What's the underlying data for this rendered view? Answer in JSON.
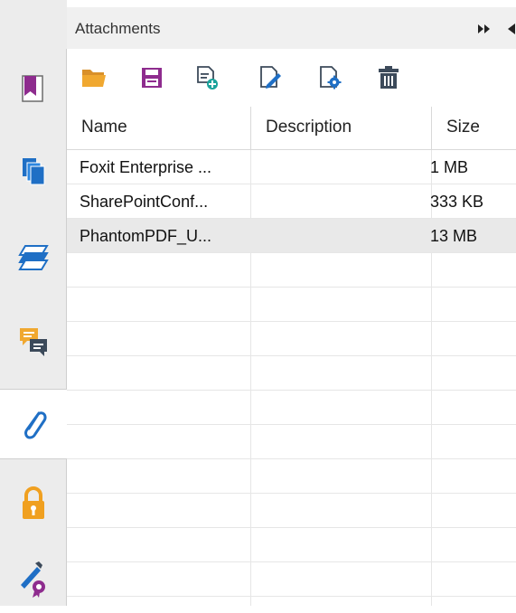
{
  "panel": {
    "title": "Attachments"
  },
  "toolbar": {
    "buttons": [
      "open-icon",
      "save-icon",
      "add-file-icon",
      "edit-description-icon",
      "properties-icon",
      "delete-icon"
    ]
  },
  "table": {
    "columns": [
      "Name",
      "Description",
      "Size"
    ],
    "rows": [
      {
        "name": "Foxit Enterprise ...",
        "description": "",
        "size": "1 MB"
      },
      {
        "name": "SharePointConf...",
        "description": "",
        "size": "333 KB"
      },
      {
        "name": "PhantomPDF_U...",
        "description": "",
        "size": "13 MB"
      }
    ],
    "selected_row": 3
  },
  "sidebar": {
    "tabs": [
      "bookmarks-icon",
      "pages-icon",
      "layers-icon",
      "comments-icon",
      "attachments-icon",
      "security-icon",
      "signatures-icon"
    ],
    "active": "attachments-icon"
  },
  "colors": {
    "folder": "#F0A830",
    "accent_purple": "#8E2C8E",
    "teal": "#1BA39C",
    "blue": "#1F6FC5",
    "slate": "#3C4A5A",
    "lock": "#F0A020"
  }
}
